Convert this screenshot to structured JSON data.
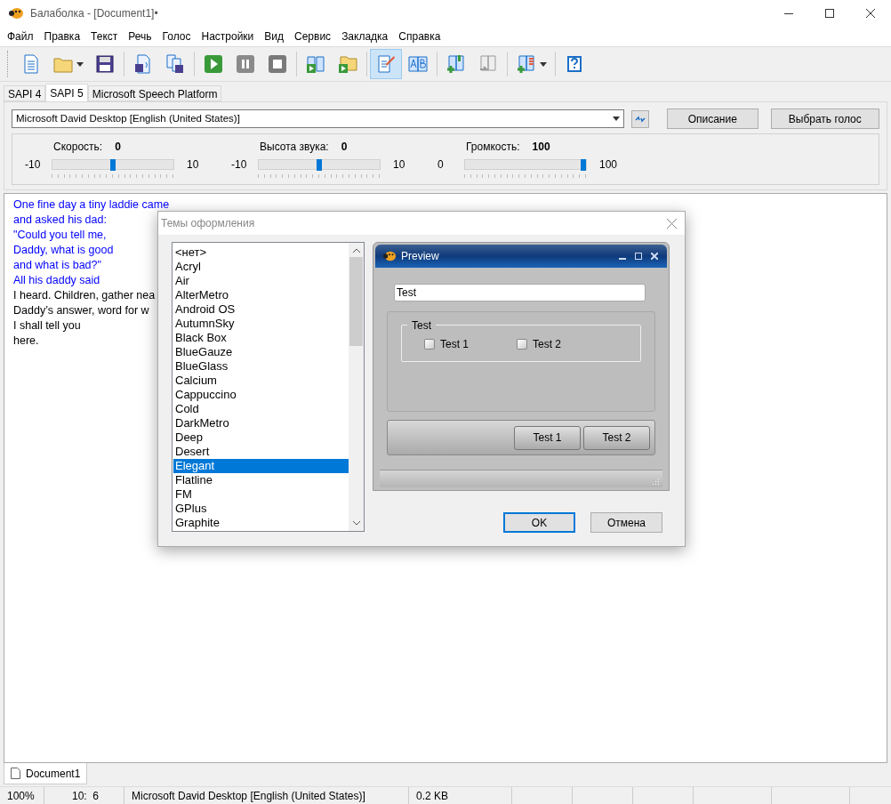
{
  "window": {
    "title": "Балаболка - [Document1]•"
  },
  "menu": [
    "Файл",
    "Правка",
    "Текст",
    "Речь",
    "Голос",
    "Настройки",
    "Вид",
    "Сервис",
    "Закладка",
    "Справка"
  ],
  "toolbar": [
    {
      "pressed": false
    },
    {
      "pressed": false
    },
    {
      "pressed": false
    },
    {
      "pressed": false
    },
    {
      "pressed": false
    },
    {
      "pressed": false
    },
    {
      "pressed": false
    },
    {
      "pressed": false
    },
    {
      "pressed": false
    },
    {
      "pressed": false
    },
    {
      "pressed": true
    },
    {
      "pressed": false
    },
    {
      "pressed": false
    },
    {
      "pressed": false
    },
    {
      "pressed": false
    },
    {
      "pressed": false
    }
  ],
  "engine_tabs": [
    {
      "label": "SAPI 4",
      "selected": false
    },
    {
      "label": "SAPI 5",
      "selected": true
    },
    {
      "label": "Microsoft Speech Platform",
      "selected": false
    }
  ],
  "voice": {
    "value": "Microsoft David Desktop [English (United States)]",
    "buttons": [
      "Описание",
      "Выбрать голос"
    ]
  },
  "sliders": [
    {
      "label": "Скорость:",
      "reading": "0",
      "min": "-10",
      "max": "10",
      "level": 0.5
    },
    {
      "label": "Высота звука:",
      "reading": "0",
      "min": "-10",
      "max": "10",
      "level": 0.5
    },
    {
      "label": "Громкость:",
      "reading": "100",
      "min": "0",
      "max": "100",
      "level": 1
    }
  ],
  "editor": {
    "lines": [
      {
        "text": "One fine day a tiny laddie came",
        "color": "#0000ff"
      },
      {
        "text": "and asked his dad:",
        "color": "#0000ff"
      },
      {
        "text": "\"Could you tell me,",
        "color": "#0000ff"
      },
      {
        "text": "Daddy, what is good",
        "color": "#0000ff"
      },
      {
        "text": "and what is bad?\"",
        "color": "#0000ff"
      },
      {
        "text": "All his daddy said",
        "color": "#0000ff"
      },
      {
        "text": "I heard. Children, gather nea",
        "color": "#000000"
      },
      {
        "text": "Daddy’s answer, word for w",
        "color": "#000000"
      },
      {
        "text": "I shall tell you",
        "color": "#000000"
      },
      {
        "text": "here.",
        "color": "#000000"
      }
    ]
  },
  "dialog": {
    "title": "Темы оформления",
    "themes": [
      {
        "label": "<нет>",
        "selected": false
      },
      {
        "label": "Acryl",
        "selected": false
      },
      {
        "label": "Air",
        "selected": false
      },
      {
        "label": "AlterMetro",
        "selected": false
      },
      {
        "label": "Android OS",
        "selected": false
      },
      {
        "label": "AutumnSky",
        "selected": false
      },
      {
        "label": "Black Box",
        "selected": false
      },
      {
        "label": "BlueGauze",
        "selected": false
      },
      {
        "label": "BlueGlass",
        "selected": false
      },
      {
        "label": "Calcium",
        "selected": false
      },
      {
        "label": "Cappuccino",
        "selected": false
      },
      {
        "label": "Cold",
        "selected": false
      },
      {
        "label": "DarkMetro",
        "selected": false
      },
      {
        "label": "Deep",
        "selected": false
      },
      {
        "label": "Desert",
        "selected": false
      },
      {
        "label": "Elegant",
        "selected": true
      },
      {
        "label": "Flatline",
        "selected": false
      },
      {
        "label": "FM",
        "selected": false
      },
      {
        "label": "GPlus",
        "selected": false
      },
      {
        "label": "Graphite",
        "selected": false
      }
    ],
    "preview": {
      "title": "Preview",
      "field_value": "Test",
      "group_title": "Test",
      "checkboxes": [
        {
          "label": "Test 1",
          "checked": false
        },
        {
          "label": "Test 2",
          "checked": false
        }
      ],
      "buttons": [
        "Test 1",
        "Test 2"
      ]
    },
    "buttons": [
      "OK",
      "Отмена"
    ]
  },
  "document_tabs": [
    {
      "label": "Document1",
      "selected": true
    }
  ],
  "status_bar": [
    "100%",
    "10:  6",
    "Microsoft David Desktop [English (United States)]",
    "0.2 KB"
  ]
}
